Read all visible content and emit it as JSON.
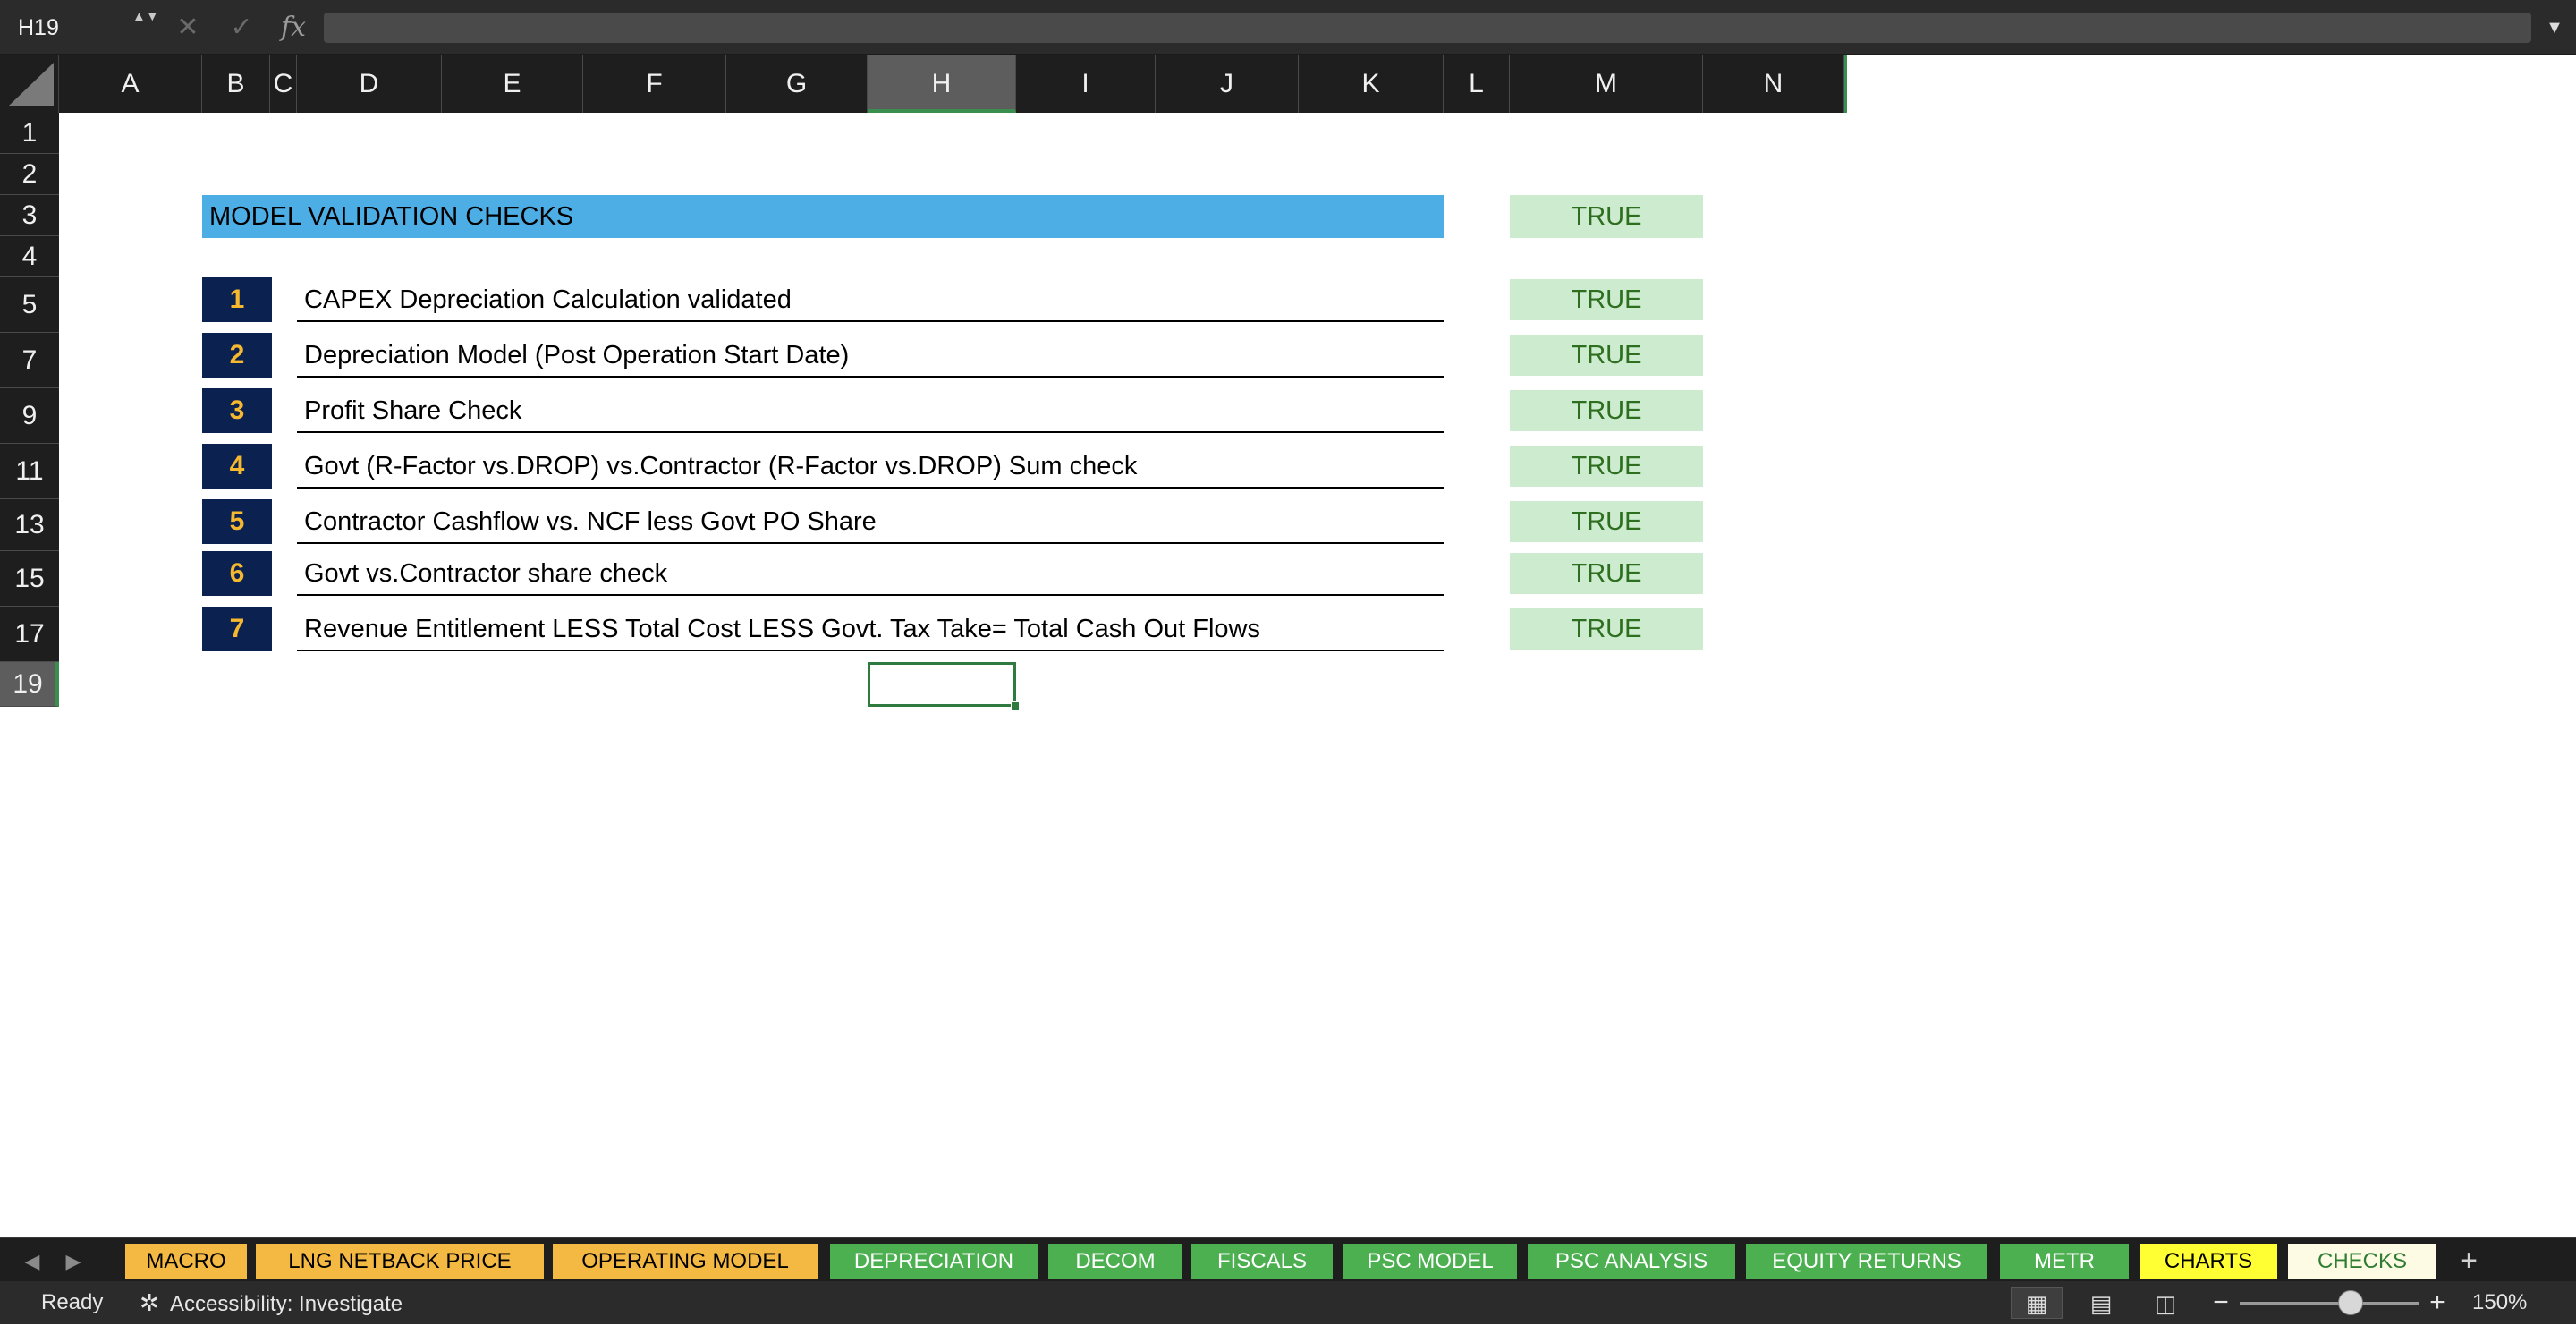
{
  "formula_bar": {
    "name_box": "H19",
    "stepper": "▲▼",
    "cancel_icon": "✕",
    "enter_icon": "✓",
    "fx_label": "fx",
    "formula_value": "",
    "expand_icon": "▼"
  },
  "grid": {
    "columns": [
      "A",
      "B",
      "C",
      "D",
      "E",
      "F",
      "G",
      "H",
      "I",
      "J",
      "K",
      "L",
      "M",
      "N"
    ],
    "rows": [
      "1",
      "2",
      "3",
      "4",
      "5",
      "7",
      "9",
      "11",
      "13",
      "15",
      "17",
      "19"
    ],
    "active_column": "H",
    "active_row": "19"
  },
  "sheet": {
    "title": "MODEL VALIDATION  CHECKS",
    "title_result": "TRUE",
    "checks": [
      {
        "num": "1",
        "label": "CAPEX Depreciation Calculation validated",
        "result": "TRUE"
      },
      {
        "num": "2",
        "label": "Depreciation Model (Post Operation Start Date)",
        "result": "TRUE"
      },
      {
        "num": "3",
        "label": "Profit Share Check",
        "result": "TRUE"
      },
      {
        "num": "4",
        "label": "Govt (R-Factor vs.DROP) vs.Contractor  (R-Factor vs.DROP) Sum check",
        "result": "TRUE"
      },
      {
        "num": "5",
        "label": "Contractor Cashflow vs. NCF less Govt PO  Share",
        "result": "TRUE"
      },
      {
        "num": "6",
        "label": "Govt vs.Contractor share check",
        "result": "TRUE"
      },
      {
        "num": "7",
        "label": "Revenue Entitlement LESS Total Cost LESS Govt. Tax Take= Total Cash Out Flows",
        "result": "TRUE"
      }
    ]
  },
  "tabs": {
    "prev_icon": "◀",
    "next_icon": "▶",
    "add_icon": "+",
    "items": [
      {
        "label": "MACRO",
        "bg": "#f4b942",
        "color": "#000000"
      },
      {
        "label": "LNG NETBACK PRICE",
        "bg": "#f4b942",
        "color": "#000000"
      },
      {
        "label": "OPERATING MODEL",
        "bg": "#f4b942",
        "color": "#000000"
      },
      {
        "label": "DEPRECIATION",
        "bg": "#4caf50",
        "color": "#ffffff"
      },
      {
        "label": "DECOM",
        "bg": "#4caf50",
        "color": "#ffffff"
      },
      {
        "label": "FISCALS",
        "bg": "#4caf50",
        "color": "#ffffff"
      },
      {
        "label": "PSC MODEL",
        "bg": "#4caf50",
        "color": "#ffffff"
      },
      {
        "label": "PSC ANALYSIS",
        "bg": "#4caf50",
        "color": "#ffffff"
      },
      {
        "label": "EQUITY RETURNS",
        "bg": "#4caf50",
        "color": "#ffffff"
      },
      {
        "label": "METR",
        "bg": "#4caf50",
        "color": "#ffffff"
      },
      {
        "label": "CHARTS",
        "bg": "#ffff33",
        "color": "#000000"
      },
      {
        "label": "CHECKS",
        "bg": "#fdfbe3",
        "color": "#2e7d32"
      }
    ]
  },
  "status": {
    "ready": "Ready",
    "accessibility_icon": "✲",
    "accessibility": "Accessibility: Investigate",
    "view_normal_icon": "▦",
    "view_page_layout_icon": "▤",
    "view_page_break_icon": "◫",
    "zoom_minus": "−",
    "zoom_plus": "+",
    "zoom_fraction": 0.62,
    "zoom_level": "150%"
  }
}
